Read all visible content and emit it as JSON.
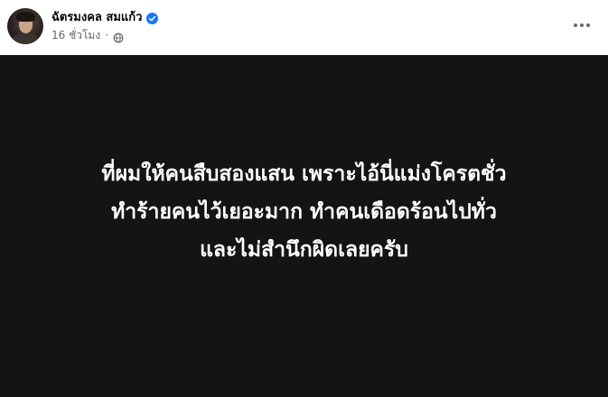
{
  "post": {
    "author_name": "ฉัตรมงคล สมแก้ว",
    "verified": true,
    "time": "16 ชั่วโมง",
    "separator": "·",
    "privacy_icon": "globe-icon",
    "more_icon": "more-horizontal-icon",
    "avatar": "profile-photo",
    "body_lines": [
      "ที่ผมให้คนสืบสองแสน เพราะไอ้นี่แม่งโครตชั่ว",
      "ทำร้ายคนไว้เยอะมาก ทำคนเดือดร้อนไปทั่ว",
      "และไม่สำนึกผิดเลยครับ"
    ]
  },
  "colors": {
    "verified_blue": "#1877f2",
    "media_background": "#141414",
    "secondary_text": "#65676b",
    "primary_text": "#050505"
  }
}
